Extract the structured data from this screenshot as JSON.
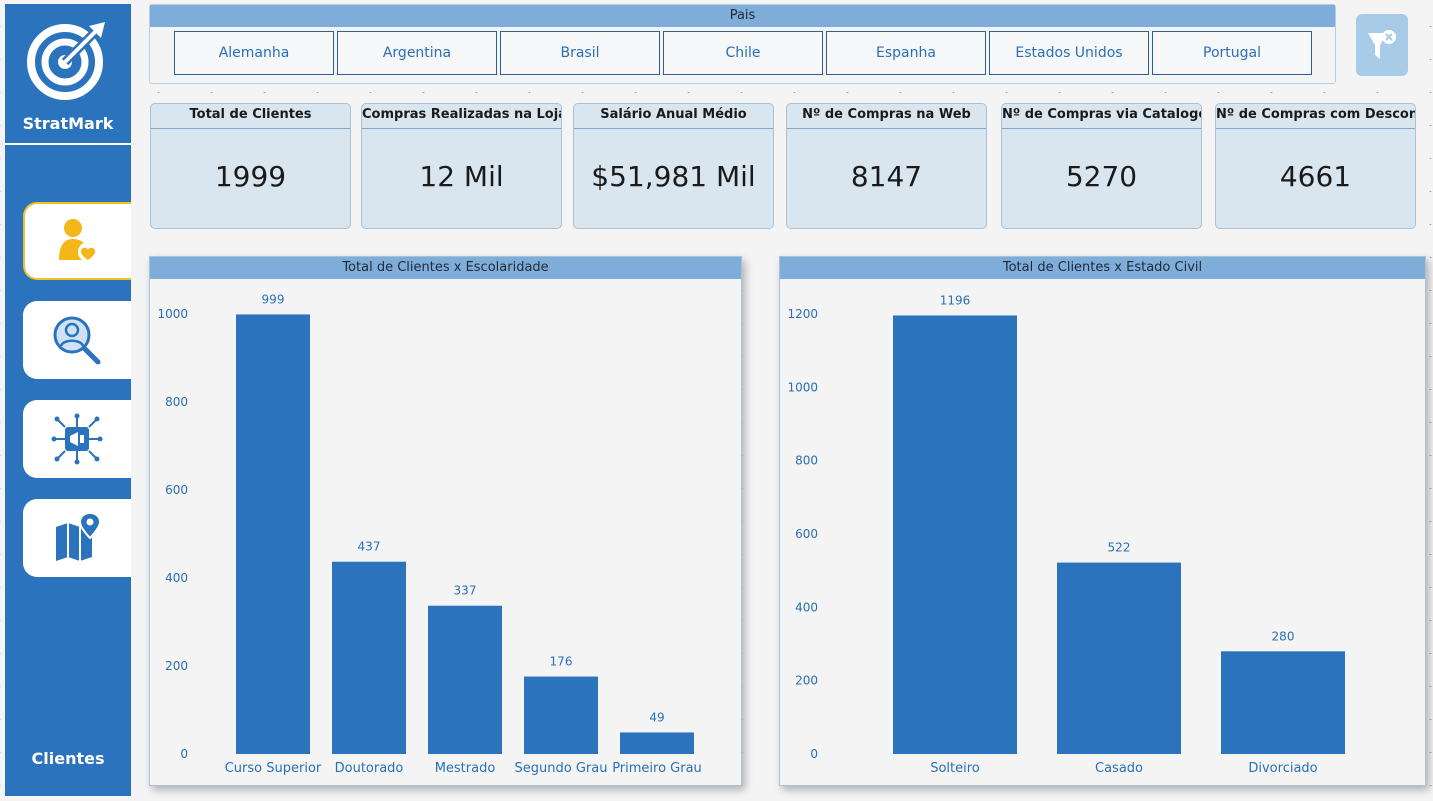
{
  "app": {
    "brand": "StratMark",
    "page": "Clientes"
  },
  "nav": [
    {
      "icon": "customer-heart-icon",
      "active": true
    },
    {
      "icon": "user-search-icon",
      "active": false
    },
    {
      "icon": "megaphone-network-icon",
      "active": false
    },
    {
      "icon": "map-pin-icon",
      "active": false
    }
  ],
  "slicer": {
    "title": "Pais",
    "items": [
      "Alemanha",
      "Argentina",
      "Brasil",
      "Chile",
      "Espanha",
      "Estados Unidos",
      "Portugal"
    ]
  },
  "filter_button": {
    "icon": "clear-filter-icon"
  },
  "kpis": [
    {
      "title": "Total de Clientes",
      "value": "1999"
    },
    {
      "title": "Compras Realizadas na Loja",
      "value": "12 Mil"
    },
    {
      "title": "Salário Anual Médio",
      "value": "$51,981 Mil"
    },
    {
      "title": "Nº de Compras na Web",
      "value": "8147"
    },
    {
      "title": "Nº de Compras via Catalogo",
      "value": "5270"
    },
    {
      "title": "Nº de Compras com Desconto",
      "value": "4661"
    }
  ],
  "colors": {
    "accent": "#2b73bc",
    "header": "#7fadda",
    "active_border": "#f2c022"
  },
  "chart_data": [
    {
      "type": "bar",
      "title": "Total de Clientes x Escolaridade",
      "categories": [
        "Curso Superior",
        "Doutorado",
        "Mestrado",
        "Segundo Grau",
        "Primeiro Grau"
      ],
      "values": [
        999,
        437,
        337,
        176,
        49
      ],
      "ylim": [
        0,
        1000
      ],
      "yticks": [
        0,
        200,
        400,
        600,
        800,
        1000
      ],
      "grid": false
    },
    {
      "type": "bar",
      "title": "Total de Clientes x Estado Civil",
      "categories": [
        "Solteiro",
        "Casado",
        "Divorciado"
      ],
      "values": [
        1196,
        522,
        280
      ],
      "ylim": [
        0,
        1200
      ],
      "yticks": [
        0,
        200,
        400,
        600,
        800,
        1000,
        1200
      ],
      "grid": false
    }
  ]
}
